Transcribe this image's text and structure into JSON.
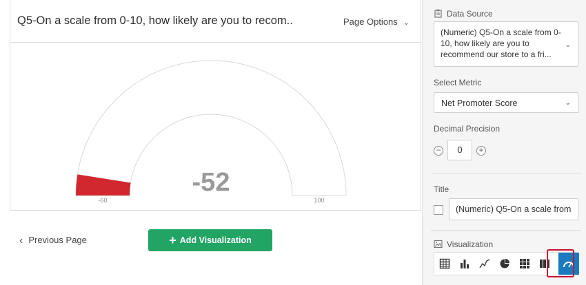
{
  "card": {
    "title": "Q5-On a scale from 0-10, how likely are you to recom...",
    "page_options_label": "Page Options"
  },
  "gauge": {
    "value_label": "-52",
    "value": -52,
    "min": -60,
    "max": 100,
    "min_label": "-60",
    "max_label": "100",
    "fill_color": "#d0282e",
    "track_color": "#ffffff"
  },
  "footer": {
    "previous_page_label": "Previous Page",
    "add_visualization_label": "Add Visualization"
  },
  "panel": {
    "data_source_label": "Data Source",
    "data_source_value": "(Numeric) Q5-On a scale from 0-10, how likely are you to recommend our store to a fri...",
    "select_metric_label": "Select Metric",
    "metric_value": "Net Promoter Score",
    "decimal_precision_label": "Decimal Precision",
    "decimal_value": "0",
    "title_label": "Title",
    "title_value": "(Numeric) Q5-On a scale from",
    "visualization_label": "Visualization",
    "visualization_types": [
      "table-icon",
      "bar-chart-icon",
      "line-chart-icon",
      "pie-chart-icon",
      "grid-icon",
      "stacked-bar-icon",
      "gauge-icon"
    ],
    "active_visualization": "gauge-icon",
    "accent_color": "#1a7ac0"
  }
}
